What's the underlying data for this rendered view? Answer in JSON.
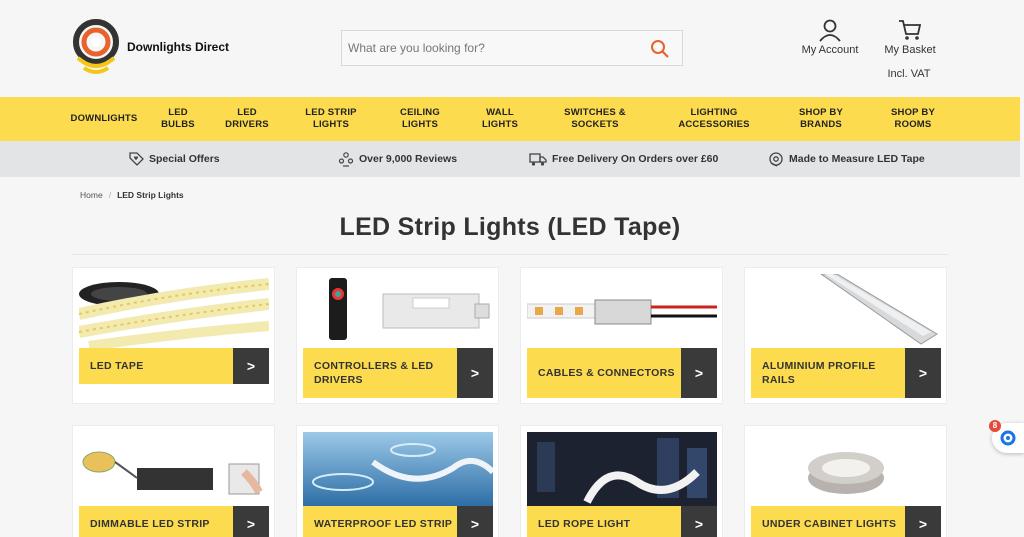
{
  "header": {
    "brand": "Downlights Direct",
    "search_placeholder": "What are you looking for?",
    "account_label": "My Account",
    "basket_label": "My Basket",
    "vat_label": "Incl. VAT"
  },
  "colors": {
    "accent": "#fcdc4e",
    "dark_button": "#3a3a3a",
    "search_icon": "#e8622c",
    "logo_orange": "#e8622c",
    "logo_yellow": "#f5c518"
  },
  "nav": [
    "DOWNLIGHTS",
    "LED\nBULBS",
    "LED\nDRIVERS",
    "LED STRIP\nLIGHTS",
    "CEILING\nLIGHTS",
    "WALL\nLIGHTS",
    "SWITCHES &\nSOCKETS",
    "LIGHTING\nACCESSORIES",
    "SHOP BY\nBRANDS",
    "SHOP BY\nROOMS"
  ],
  "usp": [
    {
      "icon": "tag-heart-icon",
      "text": "Special Offers"
    },
    {
      "icon": "reviews-icon",
      "text": "Over 9,000 Reviews"
    },
    {
      "icon": "truck-icon",
      "text": "Free Delivery On Orders over £60"
    },
    {
      "icon": "tape-icon",
      "text": "Made to Measure LED Tape"
    }
  ],
  "breadcrumb": {
    "home": "Home",
    "current": "LED Strip Lights"
  },
  "page_title": "LED Strip Lights (LED Tape)",
  "categories": [
    {
      "label": "LED TAPE",
      "arrow": ">"
    },
    {
      "label": "CONTROLLERS & LED DRIVERS",
      "arrow": ">"
    },
    {
      "label": "CABLES & CONNECTORS",
      "arrow": ">"
    },
    {
      "label": "ALUMINIUM PROFILE RAILS",
      "arrow": ">"
    },
    {
      "label": "DIMMABLE LED STRIP",
      "arrow": ">"
    },
    {
      "label": "WATERPROOF LED STRIP",
      "arrow": ">"
    },
    {
      "label": "LED ROPE LIGHT",
      "arrow": ">"
    },
    {
      "label": "UNDER CABINET LIGHTS",
      "arrow": ">"
    }
  ],
  "chat": {
    "badge": "8"
  }
}
